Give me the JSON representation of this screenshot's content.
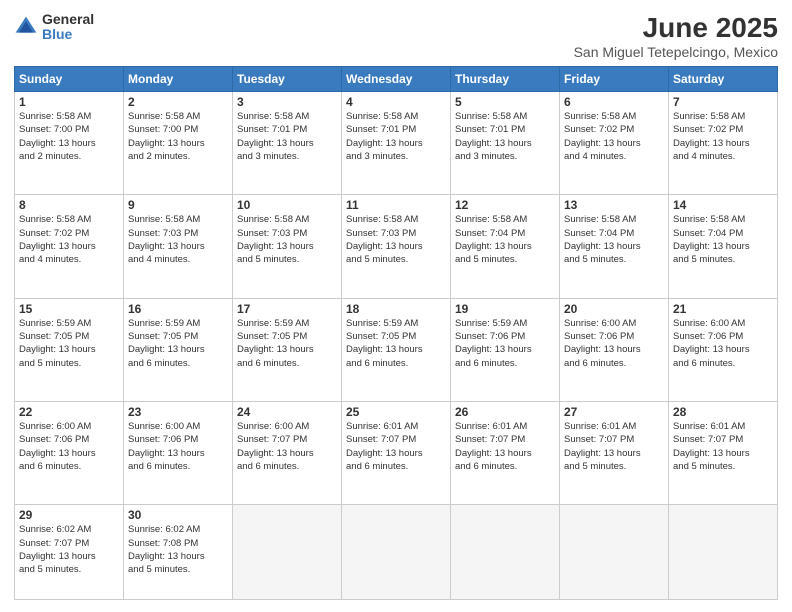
{
  "logo": {
    "general": "General",
    "blue": "Blue"
  },
  "title": "June 2025",
  "subtitle": "San Miguel Tetepelcingo, Mexico",
  "headers": [
    "Sunday",
    "Monday",
    "Tuesday",
    "Wednesday",
    "Thursday",
    "Friday",
    "Saturday"
  ],
  "weeks": [
    [
      {
        "day": "1",
        "detail": "Sunrise: 5:58 AM\nSunset: 7:00 PM\nDaylight: 13 hours\nand 2 minutes."
      },
      {
        "day": "2",
        "detail": "Sunrise: 5:58 AM\nSunset: 7:00 PM\nDaylight: 13 hours\nand 2 minutes."
      },
      {
        "day": "3",
        "detail": "Sunrise: 5:58 AM\nSunset: 7:01 PM\nDaylight: 13 hours\nand 3 minutes."
      },
      {
        "day": "4",
        "detail": "Sunrise: 5:58 AM\nSunset: 7:01 PM\nDaylight: 13 hours\nand 3 minutes."
      },
      {
        "day": "5",
        "detail": "Sunrise: 5:58 AM\nSunset: 7:01 PM\nDaylight: 13 hours\nand 3 minutes."
      },
      {
        "day": "6",
        "detail": "Sunrise: 5:58 AM\nSunset: 7:02 PM\nDaylight: 13 hours\nand 4 minutes."
      },
      {
        "day": "7",
        "detail": "Sunrise: 5:58 AM\nSunset: 7:02 PM\nDaylight: 13 hours\nand 4 minutes."
      }
    ],
    [
      {
        "day": "8",
        "detail": "Sunrise: 5:58 AM\nSunset: 7:02 PM\nDaylight: 13 hours\nand 4 minutes."
      },
      {
        "day": "9",
        "detail": "Sunrise: 5:58 AM\nSunset: 7:03 PM\nDaylight: 13 hours\nand 4 minutes."
      },
      {
        "day": "10",
        "detail": "Sunrise: 5:58 AM\nSunset: 7:03 PM\nDaylight: 13 hours\nand 5 minutes."
      },
      {
        "day": "11",
        "detail": "Sunrise: 5:58 AM\nSunset: 7:03 PM\nDaylight: 13 hours\nand 5 minutes."
      },
      {
        "day": "12",
        "detail": "Sunrise: 5:58 AM\nSunset: 7:04 PM\nDaylight: 13 hours\nand 5 minutes."
      },
      {
        "day": "13",
        "detail": "Sunrise: 5:58 AM\nSunset: 7:04 PM\nDaylight: 13 hours\nand 5 minutes."
      },
      {
        "day": "14",
        "detail": "Sunrise: 5:58 AM\nSunset: 7:04 PM\nDaylight: 13 hours\nand 5 minutes."
      }
    ],
    [
      {
        "day": "15",
        "detail": "Sunrise: 5:59 AM\nSunset: 7:05 PM\nDaylight: 13 hours\nand 5 minutes."
      },
      {
        "day": "16",
        "detail": "Sunrise: 5:59 AM\nSunset: 7:05 PM\nDaylight: 13 hours\nand 6 minutes."
      },
      {
        "day": "17",
        "detail": "Sunrise: 5:59 AM\nSunset: 7:05 PM\nDaylight: 13 hours\nand 6 minutes."
      },
      {
        "day": "18",
        "detail": "Sunrise: 5:59 AM\nSunset: 7:05 PM\nDaylight: 13 hours\nand 6 minutes."
      },
      {
        "day": "19",
        "detail": "Sunrise: 5:59 AM\nSunset: 7:06 PM\nDaylight: 13 hours\nand 6 minutes."
      },
      {
        "day": "20",
        "detail": "Sunrise: 6:00 AM\nSunset: 7:06 PM\nDaylight: 13 hours\nand 6 minutes."
      },
      {
        "day": "21",
        "detail": "Sunrise: 6:00 AM\nSunset: 7:06 PM\nDaylight: 13 hours\nand 6 minutes."
      }
    ],
    [
      {
        "day": "22",
        "detail": "Sunrise: 6:00 AM\nSunset: 7:06 PM\nDaylight: 13 hours\nand 6 minutes."
      },
      {
        "day": "23",
        "detail": "Sunrise: 6:00 AM\nSunset: 7:06 PM\nDaylight: 13 hours\nand 6 minutes."
      },
      {
        "day": "24",
        "detail": "Sunrise: 6:00 AM\nSunset: 7:07 PM\nDaylight: 13 hours\nand 6 minutes."
      },
      {
        "day": "25",
        "detail": "Sunrise: 6:01 AM\nSunset: 7:07 PM\nDaylight: 13 hours\nand 6 minutes."
      },
      {
        "day": "26",
        "detail": "Sunrise: 6:01 AM\nSunset: 7:07 PM\nDaylight: 13 hours\nand 6 minutes."
      },
      {
        "day": "27",
        "detail": "Sunrise: 6:01 AM\nSunset: 7:07 PM\nDaylight: 13 hours\nand 5 minutes."
      },
      {
        "day": "28",
        "detail": "Sunrise: 6:01 AM\nSunset: 7:07 PM\nDaylight: 13 hours\nand 5 minutes."
      }
    ],
    [
      {
        "day": "29",
        "detail": "Sunrise: 6:02 AM\nSunset: 7:07 PM\nDaylight: 13 hours\nand 5 minutes."
      },
      {
        "day": "30",
        "detail": "Sunrise: 6:02 AM\nSunset: 7:08 PM\nDaylight: 13 hours\nand 5 minutes."
      },
      {
        "day": "",
        "detail": ""
      },
      {
        "day": "",
        "detail": ""
      },
      {
        "day": "",
        "detail": ""
      },
      {
        "day": "",
        "detail": ""
      },
      {
        "day": "",
        "detail": ""
      }
    ]
  ]
}
